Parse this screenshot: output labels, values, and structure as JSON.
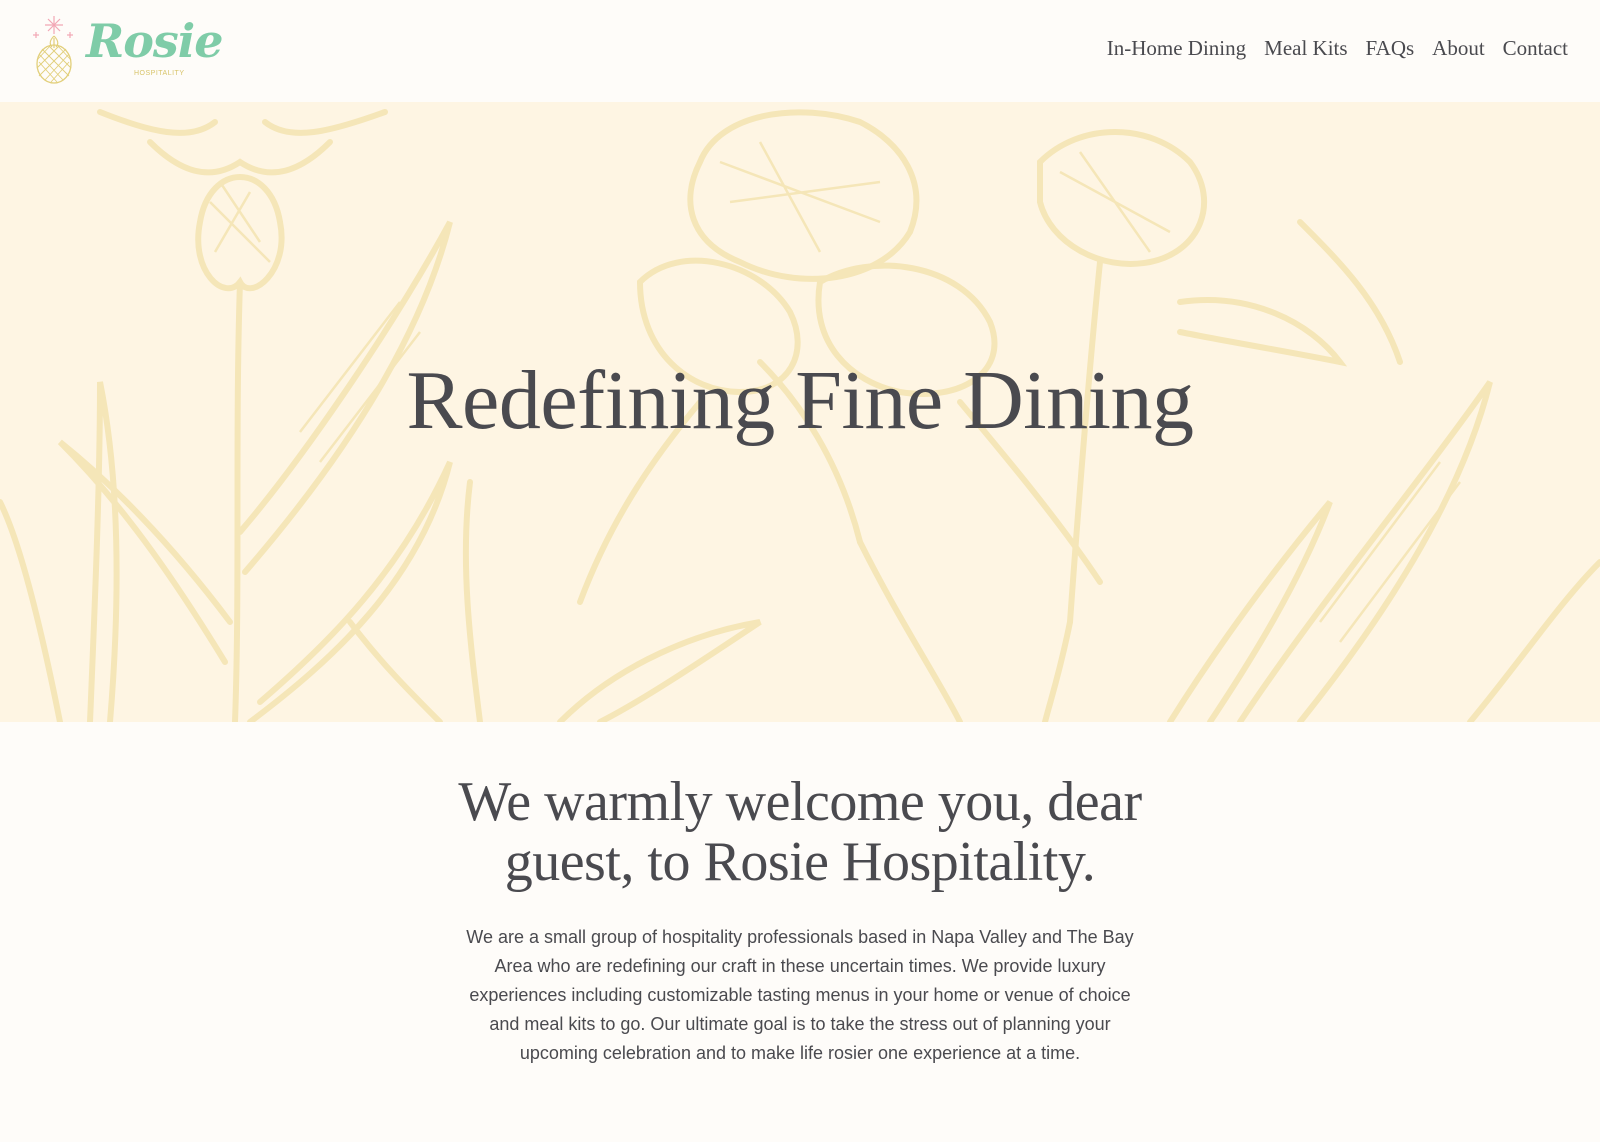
{
  "brand": {
    "name": "Rosie",
    "subtitle": "HOSPITALITY",
    "colors": {
      "logo_green": "#7fcca8",
      "pineapple_gold": "#e2cf7a",
      "sparkle_pink": "#f2a7b5",
      "hero_background": "#fef5e3",
      "hero_illustration": "#f5e6b8",
      "text": "#4a4a4f"
    },
    "logo_icon": "pineapple-icon"
  },
  "nav": {
    "items": [
      {
        "label": "In-Home Dining"
      },
      {
        "label": "Meal Kits"
      },
      {
        "label": "FAQs"
      },
      {
        "label": "About"
      },
      {
        "label": "Contact"
      }
    ]
  },
  "hero": {
    "title": "Redefining Fine Dining",
    "background_icon": "botanical-flower-illustration"
  },
  "welcome": {
    "heading": "We warmly welcome you, dear guest, to Rosie Hospitality.",
    "body": "We are a small group of hospitality professionals based in Napa Valley and The Bay Area who are redefining our craft in these uncertain times. We provide luxury experiences including customizable tasting menus in your home or venue of choice and meal kits to go. Our ultimate goal is to take the stress out of planning your upcoming celebration and to make life rosier one experience at a time."
  }
}
